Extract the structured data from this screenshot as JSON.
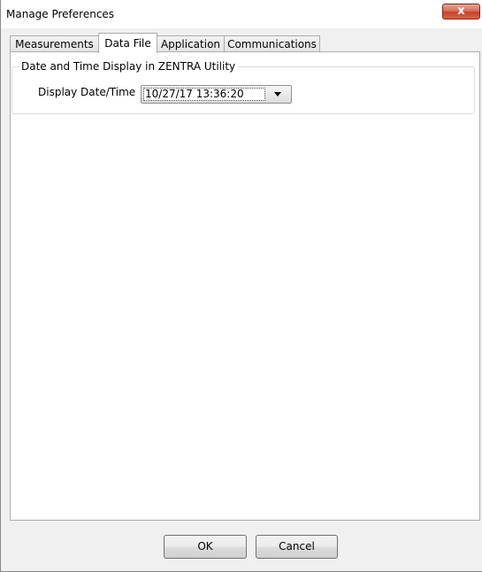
{
  "window": {
    "title": "Manage Preferences",
    "close_glyph": "x"
  },
  "tabs": [
    {
      "label": "Measurements",
      "active": false
    },
    {
      "label": "Data File",
      "active": true
    },
    {
      "label": "Application",
      "active": false
    },
    {
      "label": "Communications",
      "active": false
    }
  ],
  "group": {
    "legend": "Date and Time Display in ZENTRA Utility",
    "field_label": "Display Date/Time",
    "selected_value": "10/27/17 13:36:20"
  },
  "buttons": {
    "ok": "OK",
    "cancel": "Cancel"
  }
}
